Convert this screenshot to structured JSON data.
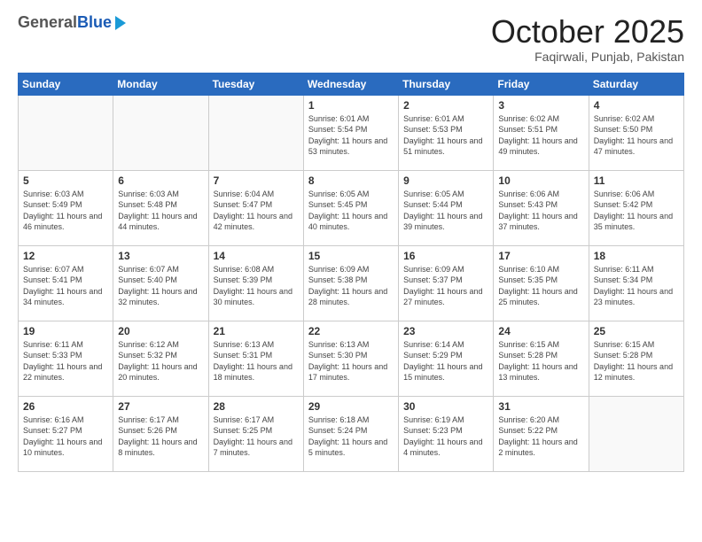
{
  "header": {
    "logo_general": "General",
    "logo_blue": "Blue",
    "month_title": "October 2025",
    "subtitle": "Faqirwali, Punjab, Pakistan"
  },
  "weekdays": [
    "Sunday",
    "Monday",
    "Tuesday",
    "Wednesday",
    "Thursday",
    "Friday",
    "Saturday"
  ],
  "days": [
    {
      "date": "",
      "info": ""
    },
    {
      "date": "",
      "info": ""
    },
    {
      "date": "",
      "info": ""
    },
    {
      "date": "1",
      "info": "Sunrise: 6:01 AM\nSunset: 5:54 PM\nDaylight: 11 hours and 53 minutes."
    },
    {
      "date": "2",
      "info": "Sunrise: 6:01 AM\nSunset: 5:53 PM\nDaylight: 11 hours and 51 minutes."
    },
    {
      "date": "3",
      "info": "Sunrise: 6:02 AM\nSunset: 5:51 PM\nDaylight: 11 hours and 49 minutes."
    },
    {
      "date": "4",
      "info": "Sunrise: 6:02 AM\nSunset: 5:50 PM\nDaylight: 11 hours and 47 minutes."
    },
    {
      "date": "5",
      "info": "Sunrise: 6:03 AM\nSunset: 5:49 PM\nDaylight: 11 hours and 46 minutes."
    },
    {
      "date": "6",
      "info": "Sunrise: 6:03 AM\nSunset: 5:48 PM\nDaylight: 11 hours and 44 minutes."
    },
    {
      "date": "7",
      "info": "Sunrise: 6:04 AM\nSunset: 5:47 PM\nDaylight: 11 hours and 42 minutes."
    },
    {
      "date": "8",
      "info": "Sunrise: 6:05 AM\nSunset: 5:45 PM\nDaylight: 11 hours and 40 minutes."
    },
    {
      "date": "9",
      "info": "Sunrise: 6:05 AM\nSunset: 5:44 PM\nDaylight: 11 hours and 39 minutes."
    },
    {
      "date": "10",
      "info": "Sunrise: 6:06 AM\nSunset: 5:43 PM\nDaylight: 11 hours and 37 minutes."
    },
    {
      "date": "11",
      "info": "Sunrise: 6:06 AM\nSunset: 5:42 PM\nDaylight: 11 hours and 35 minutes."
    },
    {
      "date": "12",
      "info": "Sunrise: 6:07 AM\nSunset: 5:41 PM\nDaylight: 11 hours and 34 minutes."
    },
    {
      "date": "13",
      "info": "Sunrise: 6:07 AM\nSunset: 5:40 PM\nDaylight: 11 hours and 32 minutes."
    },
    {
      "date": "14",
      "info": "Sunrise: 6:08 AM\nSunset: 5:39 PM\nDaylight: 11 hours and 30 minutes."
    },
    {
      "date": "15",
      "info": "Sunrise: 6:09 AM\nSunset: 5:38 PM\nDaylight: 11 hours and 28 minutes."
    },
    {
      "date": "16",
      "info": "Sunrise: 6:09 AM\nSunset: 5:37 PM\nDaylight: 11 hours and 27 minutes."
    },
    {
      "date": "17",
      "info": "Sunrise: 6:10 AM\nSunset: 5:35 PM\nDaylight: 11 hours and 25 minutes."
    },
    {
      "date": "18",
      "info": "Sunrise: 6:11 AM\nSunset: 5:34 PM\nDaylight: 11 hours and 23 minutes."
    },
    {
      "date": "19",
      "info": "Sunrise: 6:11 AM\nSunset: 5:33 PM\nDaylight: 11 hours and 22 minutes."
    },
    {
      "date": "20",
      "info": "Sunrise: 6:12 AM\nSunset: 5:32 PM\nDaylight: 11 hours and 20 minutes."
    },
    {
      "date": "21",
      "info": "Sunrise: 6:13 AM\nSunset: 5:31 PM\nDaylight: 11 hours and 18 minutes."
    },
    {
      "date": "22",
      "info": "Sunrise: 6:13 AM\nSunset: 5:30 PM\nDaylight: 11 hours and 17 minutes."
    },
    {
      "date": "23",
      "info": "Sunrise: 6:14 AM\nSunset: 5:29 PM\nDaylight: 11 hours and 15 minutes."
    },
    {
      "date": "24",
      "info": "Sunrise: 6:15 AM\nSunset: 5:28 PM\nDaylight: 11 hours and 13 minutes."
    },
    {
      "date": "25",
      "info": "Sunrise: 6:15 AM\nSunset: 5:28 PM\nDaylight: 11 hours and 12 minutes."
    },
    {
      "date": "26",
      "info": "Sunrise: 6:16 AM\nSunset: 5:27 PM\nDaylight: 11 hours and 10 minutes."
    },
    {
      "date": "27",
      "info": "Sunrise: 6:17 AM\nSunset: 5:26 PM\nDaylight: 11 hours and 8 minutes."
    },
    {
      "date": "28",
      "info": "Sunrise: 6:17 AM\nSunset: 5:25 PM\nDaylight: 11 hours and 7 minutes."
    },
    {
      "date": "29",
      "info": "Sunrise: 6:18 AM\nSunset: 5:24 PM\nDaylight: 11 hours and 5 minutes."
    },
    {
      "date": "30",
      "info": "Sunrise: 6:19 AM\nSunset: 5:23 PM\nDaylight: 11 hours and 4 minutes."
    },
    {
      "date": "31",
      "info": "Sunrise: 6:20 AM\nSunset: 5:22 PM\nDaylight: 11 hours and 2 minutes."
    },
    {
      "date": "",
      "info": ""
    }
  ]
}
